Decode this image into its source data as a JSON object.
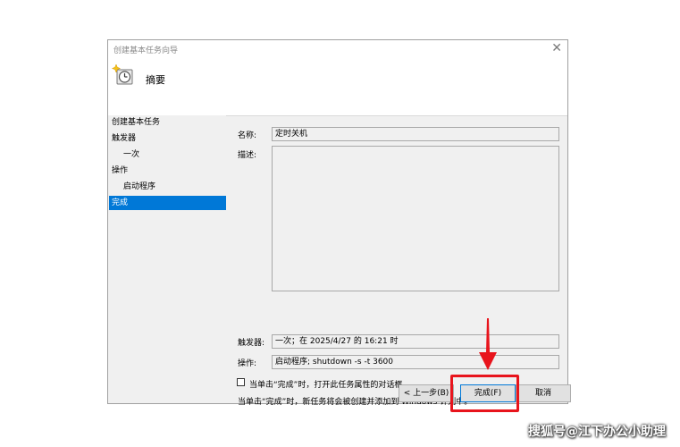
{
  "window": {
    "title": "创建基本任务向导",
    "close_glyph": "✕"
  },
  "header": {
    "heading": "摘要",
    "icon": "clock-sparkle-icon"
  },
  "nav": {
    "items": [
      {
        "label": "创建基本任务"
      },
      {
        "label": "触发器"
      },
      {
        "label": "一次"
      },
      {
        "label": "操作"
      },
      {
        "label": "启动程序"
      },
      {
        "label": "完成"
      }
    ]
  },
  "summary": {
    "name_label": "名称:",
    "name_value": "定时关机",
    "desc_label": "描述:",
    "desc_value": "",
    "trigger_label": "触发器:",
    "trigger_value": "一次；在 2025/4/27 的 16:21 时",
    "action_label": "操作:",
    "action_value": "启动程序; shutdown -s -t 3600",
    "checkbox_label": "当单击“完成”时，打开此任务属性的对话框。",
    "checkbox_checked": false,
    "info_text": "当单击“完成”时，新任务将会被创建并添加到 Windows 计划中。"
  },
  "buttons": {
    "back": "< 上一步(B)",
    "finish": "完成(F)",
    "cancel": "取消"
  },
  "annotation": {
    "color": "#e8141c"
  },
  "watermark": "搜狐号@江下办公小助理"
}
